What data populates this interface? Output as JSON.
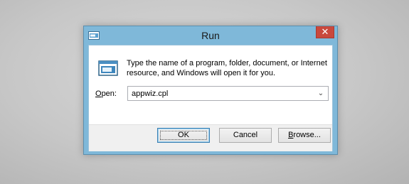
{
  "window": {
    "title": "Run",
    "close_glyph": "✕"
  },
  "dialog": {
    "description_line1": "Type the name of a program, folder, document, or Internet",
    "description_line2": "resource, and Windows will open it for you.",
    "open_label_accel": "O",
    "open_label_rest": "pen:",
    "open_value": "appwiz.cpl",
    "dropdown_glyph": "⌄"
  },
  "buttons": {
    "ok_label": "OK",
    "cancel_label": "Cancel",
    "browse_accel": "B",
    "browse_rest": "rowse..."
  },
  "icons": {
    "title_icon": "run-icon",
    "dialog_icon": "run-icon"
  },
  "colors": {
    "frame": "#7fb8d9",
    "close_button": "#c9483c",
    "desktop": "#c7c7c7"
  }
}
